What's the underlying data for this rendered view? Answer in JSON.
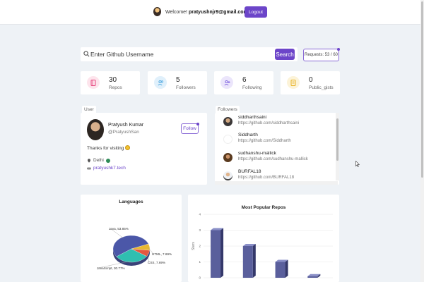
{
  "navbar": {
    "welcome_prefix": "Welcome!",
    "email": "pratyushnjr9@gmail.com",
    "logout_label": "Logout"
  },
  "search": {
    "placeholder": "Enter Github Username",
    "button_label": "Search",
    "requests_label": "Requests: 53 / 60"
  },
  "stats": [
    {
      "value": "30",
      "label": "Repos",
      "icon": "book-icon",
      "color": "#e6467e",
      "bg": "#fde4ec"
    },
    {
      "value": "5",
      "label": "Followers",
      "icon": "users-icon",
      "color": "#4aa6e0",
      "bg": "#e0f0fb"
    },
    {
      "value": "6",
      "label": "Following",
      "icon": "user-plus-icon",
      "color": "#7b5fe0",
      "bg": "#ebe5fb"
    },
    {
      "value": "0",
      "label": "Public_gists",
      "icon": "code-icon",
      "color": "#e9b224",
      "bg": "#fcf3d8"
    }
  ],
  "user": {
    "tab_label": "User",
    "name": "Pratyush Kumar",
    "handle": "@PratyushSan",
    "follow_label": "Follow",
    "bio": "Thanks for visiting",
    "location": "Delhi",
    "website": "pratyushk7.tech"
  },
  "followers": {
    "tab_label": "Followers",
    "items": [
      {
        "name": "siddharthsaini",
        "url": "https://github.com/siddharthsaini"
      },
      {
        "name": "Siddharth",
        "url": "https://github.com/Siddharth"
      },
      {
        "name": "sudhanshu-mallick",
        "url": "https://github.com/sudhanshu-mallick"
      },
      {
        "name": "BURFAL18",
        "url": "https://github.com/BURFAL18"
      }
    ]
  },
  "chart_data": [
    {
      "type": "pie",
      "title": "Languages",
      "categories": [
        "Java",
        "JavaScript",
        "CSS",
        "HTML"
      ],
      "values": [
        53.85,
        30.77,
        7.69,
        7.69
      ],
      "labels": [
        "Java, 53.85%",
        "JavaScript, 30.77%",
        "CSS, 7.69%",
        "HTML, 7.69%"
      ],
      "colors": [
        "#4b57a8",
        "#2fbfb0",
        "#e4573e",
        "#e8b832"
      ]
    },
    {
      "type": "bar",
      "title": "Most Popular Repos",
      "ylabel": "Stars",
      "ylim": [
        0,
        4
      ],
      "y_ticks": [
        "0",
        "1",
        "2",
        "3",
        "4"
      ],
      "values": [
        3,
        2,
        1,
        0.1
      ],
      "color": "#5a5f9c"
    }
  ]
}
